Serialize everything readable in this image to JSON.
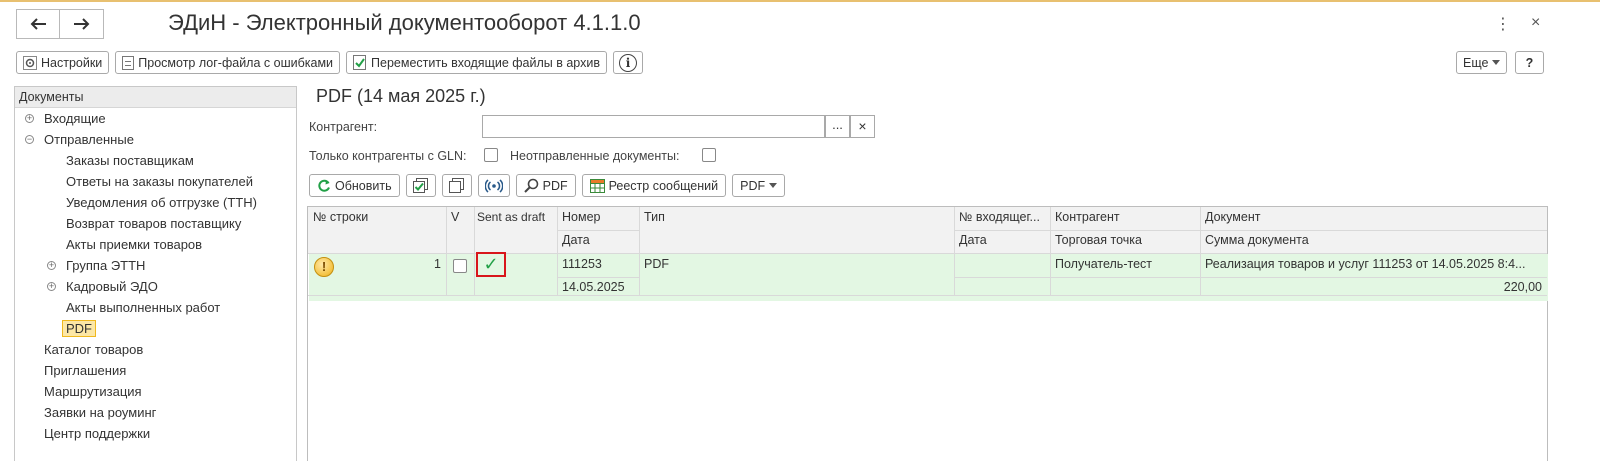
{
  "window": {
    "title": "ЭДиН - Электронный документооборот 4.1.1.0",
    "back_icon": "arrow-left-icon",
    "forward_icon": "arrow-right-icon",
    "menu_glyph": "⋮",
    "close_glyph": "×"
  },
  "commands": {
    "settings": "Настройки",
    "view_log": "Просмотр лог-файла с ошибками",
    "move_archive": "Переместить входящие файлы в архив",
    "info_glyph": "i",
    "more": "Еще",
    "help": "?"
  },
  "sidebar": {
    "header": "Документы",
    "items": [
      {
        "label": "Входящие",
        "expander": "+"
      },
      {
        "label": "Отправленные",
        "expander": "−"
      },
      {
        "label": "Заказы поставщикам"
      },
      {
        "label": "Ответы на заказы покупателей"
      },
      {
        "label": "Уведомления об отгрузке (ТТН)"
      },
      {
        "label": "Возврат товаров поставщику"
      },
      {
        "label": "Акты приемки товаров"
      },
      {
        "label": "Группа ЭТТН",
        "expander": "+"
      },
      {
        "label": "Кадровый ЭДО",
        "expander": "+"
      },
      {
        "label": "Акты выполненных работ"
      },
      {
        "label": "PDF",
        "selected": true
      },
      {
        "label": "Каталог товаров"
      },
      {
        "label": "Приглашения"
      },
      {
        "label": "Маршрутизация"
      },
      {
        "label": "Заявки на роуминг"
      },
      {
        "label": "Центр поддержки"
      }
    ]
  },
  "main": {
    "title": "PDF (14 мая 2025 г.)",
    "counterparty_label": "Контрагент:",
    "counterparty_value": "",
    "ellipsis_btn": "...",
    "clear_btn": "×",
    "only_gln_label": "Только контрагенты с GLN:",
    "unsent_label": "Неотправленные документы:",
    "toolbar": {
      "refresh": "Обновить",
      "pdf_btn": "PDF",
      "registry": "Реестр сообщений",
      "pdf_menu": "PDF"
    }
  },
  "table": {
    "headers": {
      "row_no": "№ строки",
      "v": "V",
      "sent_as_draft": "Sent as draft",
      "number": "Номер",
      "date": "Дата",
      "type": "Тип",
      "incoming_no": "№ входящег...",
      "incoming_date": "Дата",
      "counterparty": "Контрагент",
      "trade_point": "Торговая точка",
      "document": "Документ",
      "doc_sum": "Сумма документа"
    },
    "rows": [
      {
        "status_glyph": "!",
        "row_no": "1",
        "draft_glyph": "✓",
        "number": "111253",
        "date": "14.05.2025",
        "type": "PDF",
        "incoming_no": "",
        "incoming_date": "",
        "counterparty": "Получатель-тест",
        "trade_point": "",
        "document": "Реализация товаров и услуг 111253 от 14.05.2025 8:4...",
        "doc_sum": "220,00"
      }
    ]
  },
  "colors": {
    "row_highlight": "#e3f7e3",
    "selected_item_bg": "#fce7a6",
    "draft_box_border": "#d8161b",
    "check_green": "#22a047"
  }
}
